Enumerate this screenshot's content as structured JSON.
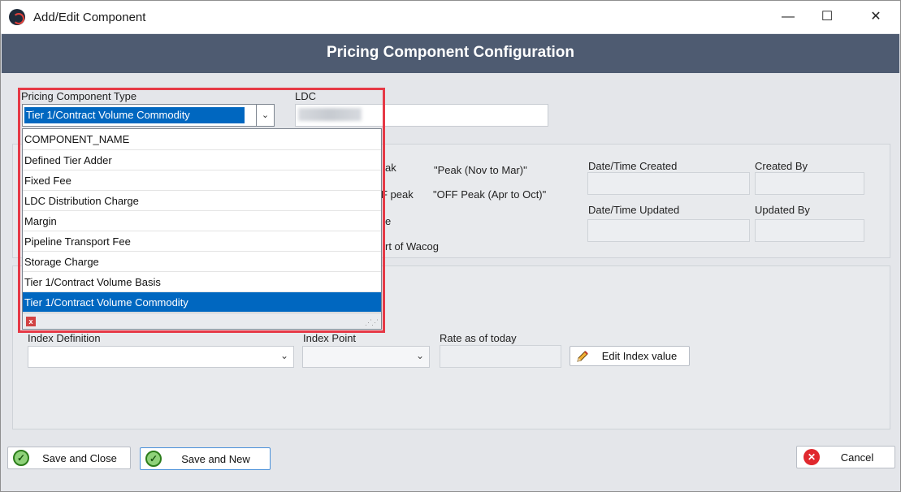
{
  "window": {
    "title": "Add/Edit Component",
    "controls": {
      "minimize": "—",
      "maximize": "☐",
      "close": "✕"
    }
  },
  "header": {
    "title": "Pricing Component Configuration"
  },
  "form": {
    "pricing_component_type_label": "Pricing Component Type",
    "pricing_component_type_value": "Tier 1/Contract Volume Commodity",
    "ldc_label": "LDC",
    "peak_partial": "ak",
    "peak_value": "\"Peak (Nov to Mar)\"",
    "off_peak_partial": "F peak",
    "off_peak_value": "\"OFF Peak (Apr to Oct)\"",
    "partial_e": "e",
    "wacog_partial": "rt of Wacog",
    "date_created_label": "Date/Time Created",
    "created_by_label": "Created By",
    "date_updated_label": "Date/Time Updated",
    "updated_by_label": "Updated By",
    "index_definition_label": "Index Definition",
    "index_point_label": "Index Point",
    "rate_today_label": "Rate as of today",
    "edit_index_button": "Edit Index value"
  },
  "dropdown": {
    "items": [
      "COMPONENT_NAME",
      "Defined Tier Adder",
      "Fixed Fee",
      "LDC Distribution Charge",
      "Margin",
      "Pipeline Transport Fee",
      "Storage Charge",
      "Tier 1/Contract Volume Basis",
      "Tier 1/Contract Volume Commodity"
    ],
    "selected_index": 8
  },
  "footer": {
    "save_close": "Save and Close",
    "save_new": "Save and New",
    "cancel": "Cancel"
  },
  "colors": {
    "header_band": "#4e5b71",
    "selection": "#0067c0",
    "highlight_border": "#e63946",
    "ok_green": "#8fd27a",
    "cancel_red": "#e0282e"
  },
  "icons": [
    "app-logo-icon",
    "pencil-icon",
    "check-circle-icon",
    "x-circle-icon",
    "chevron-down-icon",
    "clear-icon",
    "resize-grip-icon"
  ]
}
